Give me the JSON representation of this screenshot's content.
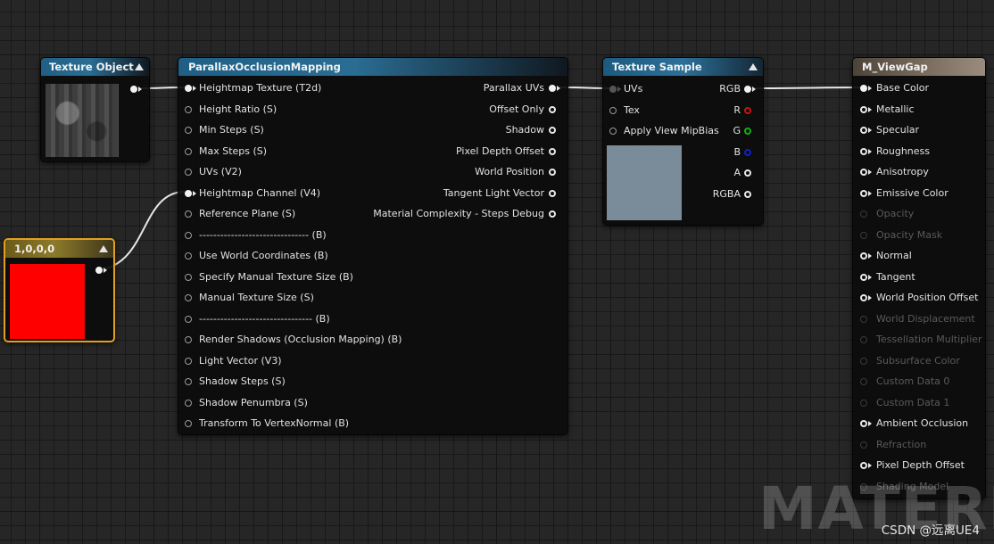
{
  "colors": {
    "canvas_bg": "#262626",
    "constant_red": "#ff0000",
    "sample_preview": "#7a8b9a",
    "pin_r": "#d01010",
    "pin_g": "#10b010",
    "pin_b": "#1020d0",
    "selection": "#e3a020"
  },
  "texture_object": {
    "title": "Texture Object"
  },
  "pom": {
    "title": "ParallaxOcclusionMapping",
    "inputs": [
      {
        "label": "Heightmap Texture (T2d)",
        "connected": true
      },
      {
        "label": "Height Ratio (S)"
      },
      {
        "label": "Min Steps (S)"
      },
      {
        "label": "Max Steps (S)"
      },
      {
        "label": "UVs (V2)"
      },
      {
        "label": "Heightmap Channel (V4)",
        "connected": true
      },
      {
        "label": "Reference Plane (S)"
      },
      {
        "label": "------------------------------- (B)"
      },
      {
        "label": "Use World Coordinates (B)"
      },
      {
        "label": "Specify Manual Texture Size (B)"
      },
      {
        "label": "Manual Texture Size (S)"
      },
      {
        "label": "-------------------------------- (B)"
      },
      {
        "label": "Render Shadows (Occlusion Mapping) (B)"
      },
      {
        "label": "Light Vector (V3)"
      },
      {
        "label": "Shadow Steps (S)"
      },
      {
        "label": "Shadow Penumbra (S)"
      },
      {
        "label": "Transform To VertexNormal (B)"
      }
    ],
    "outputs": [
      {
        "label": "Parallax UVs",
        "connected": true
      },
      {
        "label": "Offset Only"
      },
      {
        "label": "Shadow"
      },
      {
        "label": "Pixel Depth Offset"
      },
      {
        "label": "World Position"
      },
      {
        "label": "Tangent Light Vector"
      },
      {
        "label": "Material Complexity - Steps Debug"
      }
    ]
  },
  "texture_sample": {
    "title": "Texture Sample",
    "inputs": [
      {
        "label": "UVs",
        "connected": true
      },
      {
        "label": "Tex"
      },
      {
        "label": "Apply View MipBias"
      }
    ],
    "outputs": [
      {
        "label": "RGB",
        "connected": true
      },
      {
        "label": "R",
        "color": "#d01010"
      },
      {
        "label": "G",
        "color": "#10b010"
      },
      {
        "label": "B",
        "color": "#1020d0"
      },
      {
        "label": "A"
      },
      {
        "label": "RGBA"
      }
    ]
  },
  "constant": {
    "title": "1,0,0,0"
  },
  "material": {
    "title": "M_ViewGap",
    "inputs": [
      {
        "label": "Base Color",
        "connected": true,
        "enabled": true
      },
      {
        "label": "Metallic",
        "enabled": true
      },
      {
        "label": "Specular",
        "enabled": true
      },
      {
        "label": "Roughness",
        "enabled": true
      },
      {
        "label": "Anisotropy",
        "enabled": true
      },
      {
        "label": "Emissive Color",
        "enabled": true
      },
      {
        "label": "Opacity",
        "enabled": false
      },
      {
        "label": "Opacity Mask",
        "enabled": false
      },
      {
        "label": "Normal",
        "enabled": true
      },
      {
        "label": "Tangent",
        "enabled": true
      },
      {
        "label": "World Position Offset",
        "enabled": true
      },
      {
        "label": "World Displacement",
        "enabled": false
      },
      {
        "label": "Tessellation Multiplier",
        "enabled": false
      },
      {
        "label": "Subsurface Color",
        "enabled": false
      },
      {
        "label": "Custom Data 0",
        "enabled": false
      },
      {
        "label": "Custom Data 1",
        "enabled": false
      },
      {
        "label": "Ambient Occlusion",
        "enabled": true
      },
      {
        "label": "Refraction",
        "enabled": false
      },
      {
        "label": "Pixel Depth Offset",
        "enabled": true
      },
      {
        "label": "Shading Model",
        "enabled": false
      }
    ]
  },
  "watermark": {
    "text": "MATERIAL"
  },
  "credit": {
    "text": "CSDN @远离UE4"
  }
}
